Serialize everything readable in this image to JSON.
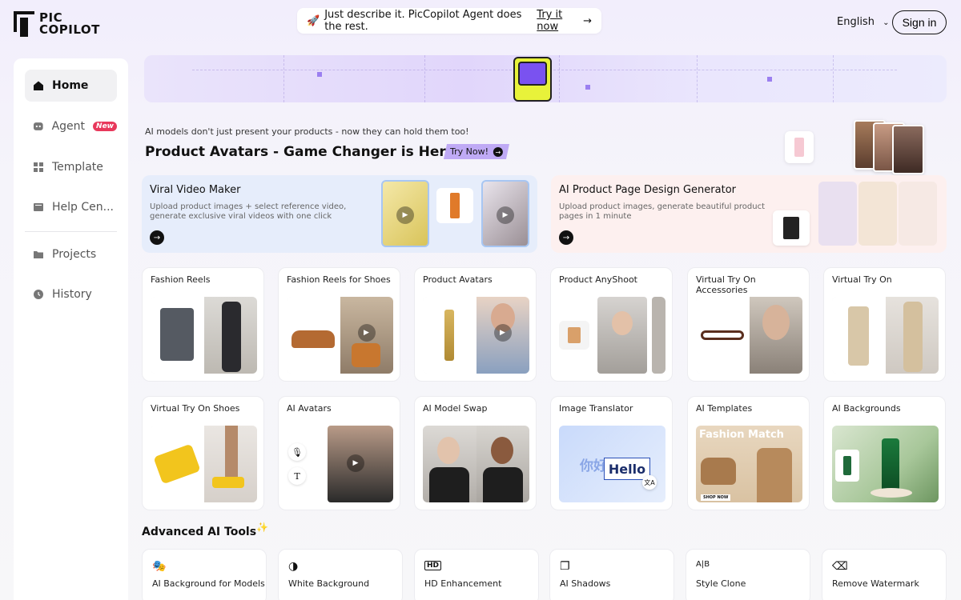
{
  "header": {
    "logo_line1": "PIC",
    "logo_line2": "COPILOT",
    "promo_text": "Just describe it. PicCopilot Agent does the rest.",
    "promo_link": "Try it now",
    "language": "English",
    "signin_label": "Sign in"
  },
  "sidebar": {
    "items": [
      {
        "label": "Home",
        "icon": "home-icon"
      },
      {
        "label": "Agent",
        "icon": "agent-icon",
        "badge": "New"
      },
      {
        "label": "Template",
        "icon": "template-icon"
      },
      {
        "label": "Help Cen...",
        "icon": "help-icon"
      },
      {
        "label": "Projects",
        "icon": "folder-icon"
      },
      {
        "label": "History",
        "icon": "history-icon"
      }
    ]
  },
  "hero": {
    "subtitle": "AI models don't just present your products - now they can hold them too!",
    "headline": "Product Avatars - Game Changer is Here!",
    "cta": "Try Now!"
  },
  "features": [
    {
      "title": "Viral Video Maker",
      "description": "Upload product images + select reference video, generate exclusive viral videos with one click"
    },
    {
      "title": "AI Product Page Design Generator",
      "description": "Upload product images, generate beautiful product pages in 1 minute"
    }
  ],
  "tools_row1": [
    {
      "title": "Fashion Reels"
    },
    {
      "title": "Fashion Reels for Shoes"
    },
    {
      "title": "Product Avatars"
    },
    {
      "title": "Product AnyShoot"
    },
    {
      "title": "Virtual Try On Accessories"
    },
    {
      "title": "Virtual Try On"
    }
  ],
  "tools_row2": [
    {
      "title": "Virtual Try On Shoes"
    },
    {
      "title": "AI Avatars"
    },
    {
      "title": "AI Model Swap"
    },
    {
      "title": "Image Translator"
    },
    {
      "title": "AI Templates"
    },
    {
      "title": "AI Backgrounds"
    }
  ],
  "image_translator": {
    "source": "你好",
    "target": "Hello"
  },
  "ai_templates": {
    "banner": "Fashion Match",
    "tag": "SHOP NOW"
  },
  "advanced": {
    "title": "Advanced AI Tools",
    "items": [
      {
        "label": "AI Background for Models",
        "icon": "model-bg-icon"
      },
      {
        "label": "White Background",
        "icon": "white-bg-icon"
      },
      {
        "label": "HD Enhancement",
        "icon": "hd-icon",
        "glyph": "HD"
      },
      {
        "label": "AI Shadows",
        "icon": "shadow-icon"
      },
      {
        "label": "Style Clone",
        "icon": "style-clone-icon",
        "glyph": "A|B"
      },
      {
        "label": "Remove Watermark",
        "icon": "eraser-icon"
      }
    ]
  },
  "colors": {
    "accent": "#7a52f0",
    "badge": "#e8385b",
    "cta_bg": "#bfaaf5"
  }
}
